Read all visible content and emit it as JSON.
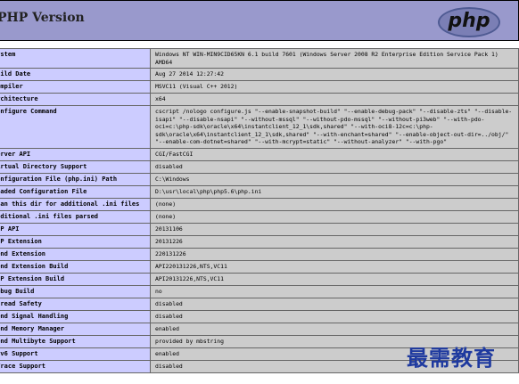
{
  "header": {
    "title": "PHP Version",
    "logo_text": "php",
    "background": "#9999cc"
  },
  "table": {
    "key_color": "#ccccff",
    "value_color": "#cccccc",
    "rows": [
      {
        "key": "System",
        "value": "Windows NT WIN-MIN9CID65KN 6.1 build 7601 (Windows Server 2008 R2 Enterprise Edition Service Pack 1) AMD64"
      },
      {
        "key": "Build Date",
        "value": "Aug 27 2014 12:27:42"
      },
      {
        "key": "Compiler",
        "value": "MSVC11 (Visual C++ 2012)"
      },
      {
        "key": "Architecture",
        "value": "x64"
      },
      {
        "key": "Configure Command",
        "value": "cscript /nologo configure.js \"--enable-snapshot-build\" \"--enable-debug-pack\" \"--disable-zts\" \"--disable-isapi\" \"--disable-nsapi\" \"--without-mssql\" \"--without-pdo-mssql\" \"--without-pi3web\" \"--with-pdo-oci=c:\\php-sdk\\oracle\\x64\\instantclient_12_1\\sdk,shared\" \"--with-oci8-12c=c:\\php-sdk\\oracle\\x64\\instantclient_12_1\\sdk,shared\" \"--with-enchant=shared\" \"--enable-object-out-dir=../obj/\" \"--enable-com-dotnet=shared\" \"--with-mcrypt=static\" \"--without-analyzer\" \"--with-pgo\""
      },
      {
        "key": "Server API",
        "value": "CGI/FastCGI"
      },
      {
        "key": "Virtual Directory Support",
        "value": "disabled"
      },
      {
        "key": "Configuration File (php.ini) Path",
        "value": "C:\\Windows"
      },
      {
        "key": "Loaded Configuration File",
        "value": "D:\\usr\\local\\php\\php5.6\\php.ini"
      },
      {
        "key": "Scan this dir for additional .ini files",
        "value": "(none)"
      },
      {
        "key": "Additional .ini files parsed",
        "value": "(none)"
      },
      {
        "key": "PHP API",
        "value": "20131106"
      },
      {
        "key": "PHP Extension",
        "value": "20131226"
      },
      {
        "key": "Zend Extension",
        "value": "220131226"
      },
      {
        "key": "Zend Extension Build",
        "value": "API220131226,NTS,VC11"
      },
      {
        "key": "PHP Extension Build",
        "value": "API20131226,NTS,VC11"
      },
      {
        "key": "Debug Build",
        "value": "no"
      },
      {
        "key": "Thread Safety",
        "value": "disabled"
      },
      {
        "key": "Zend Signal Handling",
        "value": "disabled"
      },
      {
        "key": "Zend Memory Manager",
        "value": "enabled"
      },
      {
        "key": "Zend Multibyte Support",
        "value": "provided by mbstring"
      },
      {
        "key": "IPv6 Support",
        "value": "enabled"
      },
      {
        "key": "DTrace Support",
        "value": "disabled"
      }
    ]
  },
  "watermark": {
    "text": "最需教育",
    "color": "#1f3a9f"
  }
}
